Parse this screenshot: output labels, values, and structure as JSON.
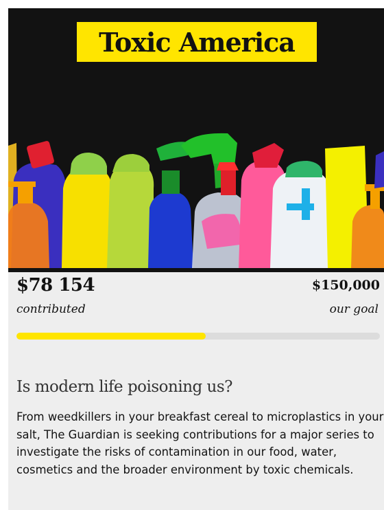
{
  "campaign": {
    "title": "Toxic America",
    "contributed_amount": "$78 154",
    "contributed_label": "contributed",
    "goal_amount": "$150,000",
    "goal_label": "our goal",
    "progress_fraction": 0.521,
    "headline": "Is modern life poisoning us?",
    "body": "From weedkillers in your breakfast cereal to microplastics in your salt, The Guardian is seeking contributions for a major series to investigate the risks of contamination in our food, water, cosmetics and the broader environment by toxic chemicals."
  },
  "colors": {
    "accent": "#ffe500",
    "hero_background": "#121212",
    "card_background": "#eeeeee",
    "track": "#dcdcdc"
  }
}
